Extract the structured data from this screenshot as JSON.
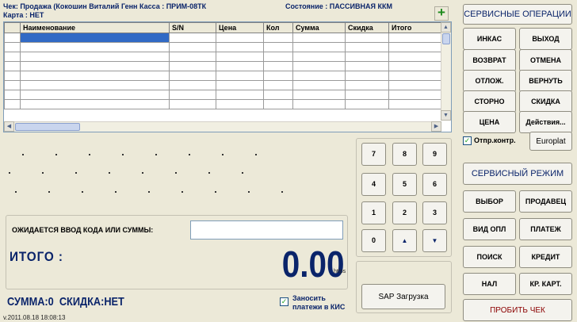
{
  "header": {
    "check_line": "Чек: Продажа (Кокошин Виталий Генн Касса : ПРИМ-08ТК",
    "card_line": "Карта : НЕТ",
    "state_line": "Состояние : ПАССИВНАЯ ККМ"
  },
  "grid": {
    "columns": [
      "Наименование",
      "S/N",
      "Цена",
      "Кол",
      "Сумма",
      "Скидка",
      "Итого"
    ],
    "row_count": 8
  },
  "numpad": {
    "keys": [
      "7",
      "8",
      "9",
      "4",
      "5",
      "6",
      "1",
      "2",
      "3",
      "0",
      "▲",
      "▼"
    ]
  },
  "entry": {
    "prompt": "ОЖИДАЕТСЯ ВВОД КОДА ИЛИ СУММЫ:",
    "value": "",
    "total_label": "ИТОГО :",
    "total_value": "0.00"
  },
  "footer": {
    "summary": "СУММА:0  СКИДКА:НЕТ",
    "version": "v.2011.08.18 18:08:13",
    "https_label": "https",
    "kis_checkbox_label_1": "Заносить",
    "kis_checkbox_label_2": "платежи в КИС",
    "sap_button": "SAP Загрузка"
  },
  "operations": {
    "header": "СЕРВИСНЫЕ ОПЕРАЦИИ",
    "buttons": [
      "ИНКАС",
      "ВЫХОД",
      "ВОЗВРАТ",
      "ОТМЕНА",
      "ОТЛОЖ.",
      "ВЕРНУТЬ",
      "СТОРНО",
      "СКИДКА",
      "ЦЕНА",
      "Действия..."
    ],
    "otpr_label": "Отпр.контр.",
    "europlat_button": "Europlat"
  },
  "service_mode": {
    "header": "СЕРВИСНЫЙ РЕЖИМ",
    "buttons": [
      "ВЫБОР",
      "ПРОДАВЕЦ",
      "ВИД ОПЛ",
      "ПЛАТЕЖ",
      "ПОИСК",
      "КРЕДИТ",
      "НАЛ",
      "КР. КАРТ."
    ],
    "print_button": "ПРОБИТЬ ЧЕК"
  },
  "colors": {
    "background": "#ece9d8",
    "header_text": "#0a246a",
    "selection": "#316ac5",
    "print_button_text": "#8b0000"
  }
}
